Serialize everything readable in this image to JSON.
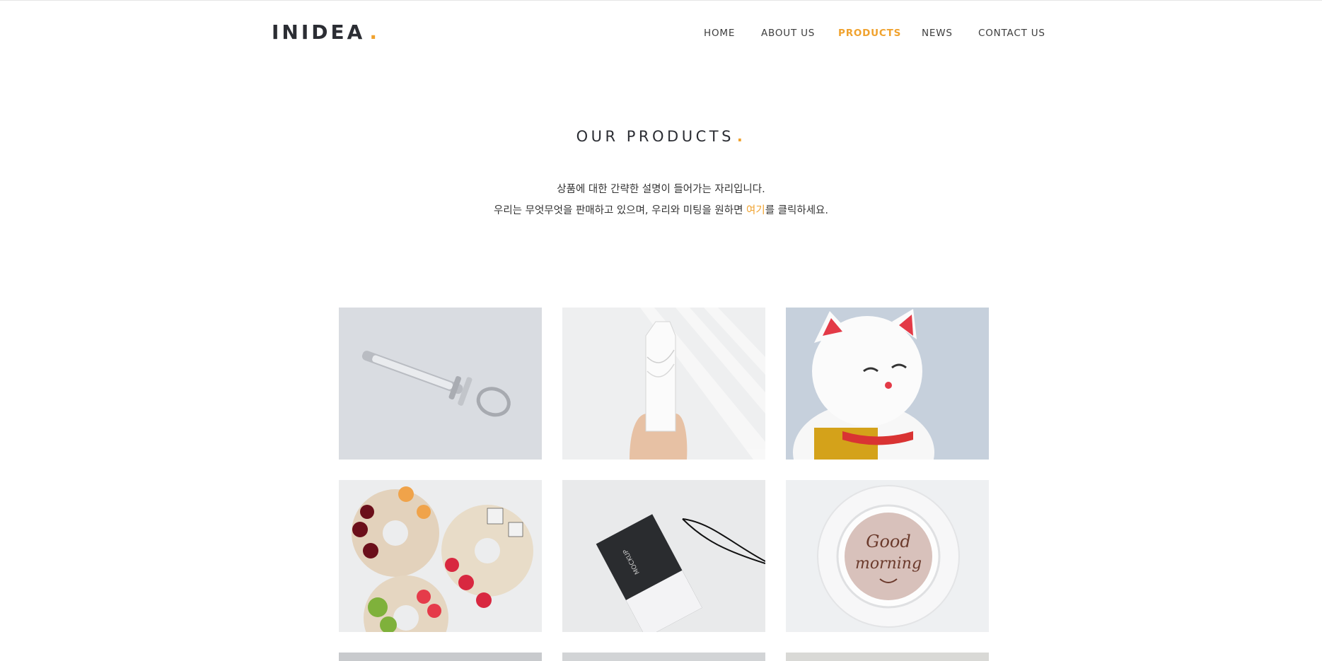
{
  "header": {
    "logo": "INIDEA",
    "logo_dot": ".",
    "nav": [
      {
        "label": "HOME",
        "active": false
      },
      {
        "label": "ABOUT US",
        "active": false
      },
      {
        "label": "PRODUCTS",
        "active": true
      },
      {
        "label": "NEWS",
        "active": false
      },
      {
        "label": "CONTACT US",
        "active": false
      }
    ]
  },
  "section": {
    "title": "OUR PRODUCTS",
    "title_dot": ".",
    "desc_line1": "상품에 대한 간략한 설명이 들어가는 자리입니다.",
    "desc_line2_before": "우리는 무엇무엇을 판매하고 있으며, 우리와 미팅을 원하면 ",
    "desc_line2_link": "여기",
    "desc_line2_after": "를 클릭하세요."
  },
  "products": [
    {
      "icon": "syringe-photo"
    },
    {
      "icon": "milk-carton-photo"
    },
    {
      "icon": "lucky-cat-photo"
    },
    {
      "icon": "fruit-bagel-photo"
    },
    {
      "icon": "hang-tag-photo",
      "text": "MOCKUP"
    },
    {
      "icon": "latte-art-photo",
      "text_line1": "Good",
      "text_line2": "morning"
    }
  ],
  "colors": {
    "accent": "#f0a22e",
    "text": "#2b2d33"
  }
}
